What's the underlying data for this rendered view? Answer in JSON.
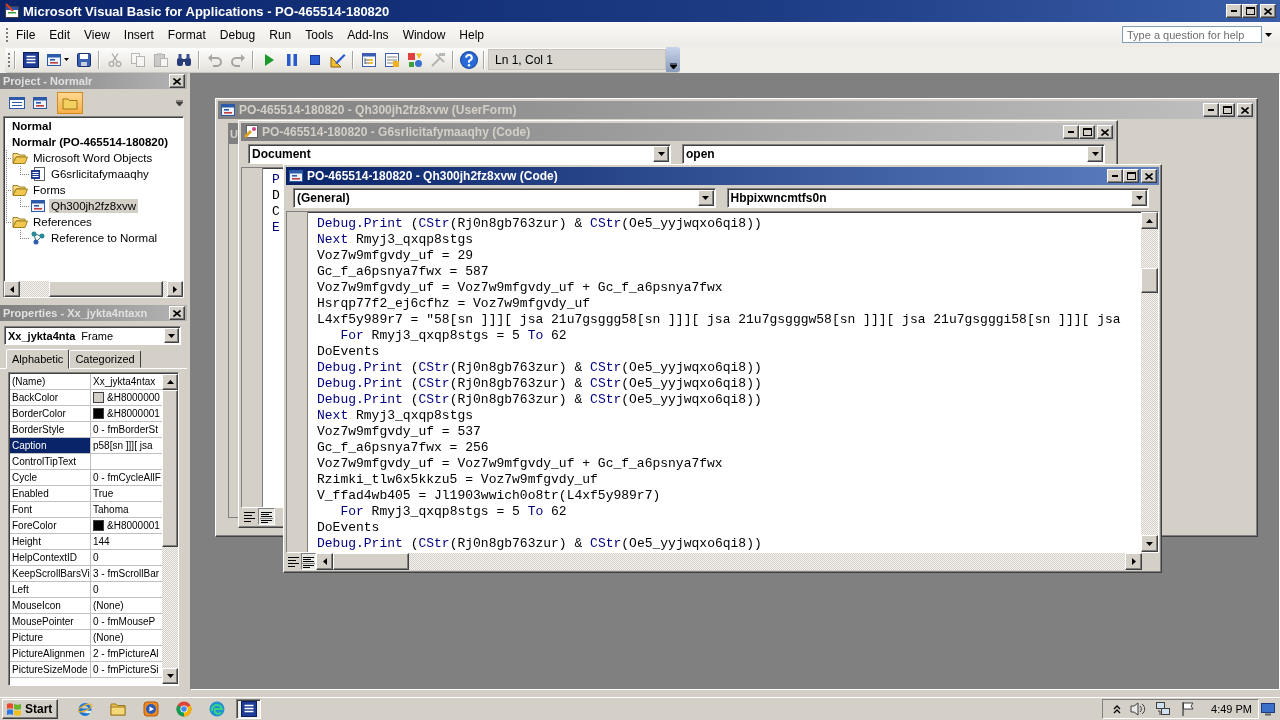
{
  "window": {
    "title": "Microsoft Visual Basic for Applications - PO-465514-180820"
  },
  "menu": [
    "File",
    "Edit",
    "View",
    "Insert",
    "Format",
    "Debug",
    "Run",
    "Tools",
    "Add-Ins",
    "Window",
    "Help"
  ],
  "help_box": {
    "placeholder": "Type a question for help"
  },
  "toolbar": {
    "groups": [
      [
        {
          "disabled": false
        },
        {
          "disabled": false
        },
        {
          "disabled": false
        }
      ],
      [
        {
          "disabled": true
        },
        {
          "disabled": true
        },
        {
          "disabled": true
        },
        {
          "disabled": false
        }
      ],
      [
        {
          "disabled": true
        },
        {
          "disabled": true
        }
      ],
      [
        {
          "disabled": false
        },
        {
          "disabled": false
        },
        {
          "disabled": false
        },
        {
          "disabled": false
        }
      ],
      [
        {
          "disabled": false
        },
        {
          "disabled": false
        },
        {
          "disabled": false
        },
        {
          "disabled": true
        }
      ],
      [
        {
          "disabled": false
        }
      ]
    ],
    "position": "Ln 1, Col 1"
  },
  "project": {
    "title": "Project - Normalr",
    "views": [
      {
        "selected": false
      },
      {
        "selected": false
      },
      {
        "selected": true
      }
    ],
    "tree": [
      {
        "label": "Normal",
        "kind": "project",
        "selected": false
      },
      {
        "label": "Normalr (PO-465514-180820)",
        "kind": "project",
        "selected": false,
        "children": [
          {
            "label": "Microsoft Word Objects",
            "kind": "folder",
            "selected": false,
            "children": [
              {
                "label": "G6srlicitafymaaqhy",
                "kind": "document",
                "selected": false
              }
            ]
          },
          {
            "label": "Forms",
            "kind": "folder",
            "selected": false,
            "children": [
              {
                "label": "Qh300jh2fz8xvw",
                "kind": "form",
                "selected": true
              }
            ]
          },
          {
            "label": "References",
            "kind": "folder",
            "selected": false,
            "children": [
              {
                "label": "Reference to Normal",
                "kind": "reference",
                "selected": false
              }
            ]
          }
        ]
      }
    ]
  },
  "properties": {
    "title": "Properties - Xx_jykta4ntaxn",
    "object": {
      "name": "Xx_jykta4nta",
      "type": "Frame"
    },
    "tabs": [
      {
        "label": "Alphabetic",
        "selected": true
      },
      {
        "label": "Categorized",
        "selected": false
      }
    ],
    "rows": [
      {
        "name": "(Name)",
        "value": "Xx_jykta4ntax",
        "selected": false
      },
      {
        "name": "BackColor",
        "value": "&H8000000",
        "color": "#d4d0c8",
        "selected": false
      },
      {
        "name": "BorderColor",
        "value": "&H8000001",
        "color": "#000000",
        "selected": false
      },
      {
        "name": "BorderStyle",
        "value": "0 - fmBorderSt",
        "selected": false
      },
      {
        "name": "Caption",
        "value": "p58[sn ]]][ jsa",
        "selected": true
      },
      {
        "name": "ControlTipText",
        "selected": false
      },
      {
        "name": "Cycle",
        "value": "0 - fmCycleAllF",
        "selected": false
      },
      {
        "name": "Enabled",
        "value": "True",
        "selected": false
      },
      {
        "name": "Font",
        "value": "Tahoma",
        "selected": false
      },
      {
        "name": "ForeColor",
        "value": "&H8000001",
        "color": "#000000",
        "selected": false
      },
      {
        "name": "Height",
        "value": "144",
        "selected": false
      },
      {
        "name": "HelpContextID",
        "value": "0",
        "selected": false
      },
      {
        "name": "KeepScrollBarsVi",
        "value": "3 - fmScrollBar",
        "selected": false
      },
      {
        "name": "Left",
        "value": "0",
        "selected": false
      },
      {
        "name": "MouseIcon",
        "value": "(None)",
        "selected": false
      },
      {
        "name": "MousePointer",
        "value": "0 - fmMouseP",
        "selected": false
      },
      {
        "name": "Picture",
        "value": "(None)",
        "selected": false
      },
      {
        "name": "PictureAlignmen",
        "value": "2 - fmPictureAl",
        "selected": false
      },
      {
        "name": "PictureSizeMode",
        "value": "0 - fmPictureSi",
        "selected": false
      }
    ]
  },
  "mdi_windows": [
    {
      "kind": "form",
      "title": "PO-465514-180820 - Qh300jh2fz8xvw (UserForm)",
      "active": false,
      "form_caption": "U"
    },
    {
      "kind": "code",
      "title": "PO-465514-180820 - G6srlicitafymaaqhy (Code)",
      "active": false,
      "object": "Document",
      "procedure": "open",
      "view_buttons": [
        {
          "selected": false
        },
        {
          "selected": true
        }
      ],
      "lines": [
        [
          {
            "text": "P",
            "kind": "keyword"
          }
        ],
        [
          {
            "text": "D",
            "kind": "plain"
          }
        ],
        [
          {
            "text": "C",
            "kind": "plain"
          }
        ],
        [
          {
            "text": "E",
            "kind": "keyword"
          }
        ]
      ]
    },
    {
      "kind": "code",
      "title": "PO-465514-180820 - Qh300jh2fz8xvw (Code)",
      "active": true,
      "object": "(General)",
      "procedure": "Hbpixwncmtfs0n",
      "view_buttons": [
        {
          "selected": false
        },
        {
          "selected": true
        }
      ],
      "lines": [
        [
          {
            "text": "Debug.Print",
            "kind": "keyword"
          },
          {
            "text": " (",
            "kind": "plain"
          },
          {
            "text": "CStr",
            "kind": "keyword"
          },
          {
            "text": "(Rj0n8gb763zur) & ",
            "kind": "plain"
          },
          {
            "text": "CStr",
            "kind": "keyword"
          },
          {
            "text": "(Oe5_yyjwqxo6qi8))",
            "kind": "plain"
          }
        ],
        [
          {
            "text": "Next",
            "kind": "keyword"
          },
          {
            "text": " Rmyj3_qxqp8stgs",
            "kind": "plain"
          }
        ],
        [
          {
            "text": "Voz7w9mfgvdy_uf = 29",
            "kind": "plain"
          }
        ],
        [
          {
            "text": "Gc_f_a6psnya7fwx = 587",
            "kind": "plain"
          }
        ],
        [
          {
            "text": "Voz7w9mfgvdy_uf = Voz7w9mfgvdy_uf + Gc_f_a6psnya7fwx",
            "kind": "plain"
          }
        ],
        [
          {
            "text": "Hsrqp77f2_ej6cfhz = Voz7w9mfgvdy_uf",
            "kind": "plain"
          }
        ],
        [
          {
            "text": "L4xf5y989r7 = \"58[sn ]]][ jsa 21u7gsggg58[sn ]]][ jsa 21u7gsgggw58[sn ]]][ jsa 21u7gsgggi58[sn ]]][ jsa",
            "kind": "plain"
          }
        ],
        [
          {
            "text": "   For",
            "kind": "keyword"
          },
          {
            "text": " Rmyj3_qxqp8stgs = 5 ",
            "kind": "plain"
          },
          {
            "text": "To",
            "kind": "keyword"
          },
          {
            "text": " 62",
            "kind": "plain"
          }
        ],
        [
          {
            "text": "DoEvents",
            "kind": "plain"
          }
        ],
        [
          {
            "text": "Debug.Print",
            "kind": "keyword"
          },
          {
            "text": " (",
            "kind": "plain"
          },
          {
            "text": "CStr",
            "kind": "keyword"
          },
          {
            "text": "(Rj0n8gb763zur) & ",
            "kind": "plain"
          },
          {
            "text": "CStr",
            "kind": "keyword"
          },
          {
            "text": "(Oe5_yyjwqxo6qi8))",
            "kind": "plain"
          }
        ],
        [
          {
            "text": "Debug.Print",
            "kind": "keyword"
          },
          {
            "text": " (",
            "kind": "plain"
          },
          {
            "text": "CStr",
            "kind": "keyword"
          },
          {
            "text": "(Rj0n8gb763zur) & ",
            "kind": "plain"
          },
          {
            "text": "CStr",
            "kind": "keyword"
          },
          {
            "text": "(Oe5_yyjwqxo6qi8))",
            "kind": "plain"
          }
        ],
        [
          {
            "text": "Debug.Print",
            "kind": "keyword"
          },
          {
            "text": " (",
            "kind": "plain"
          },
          {
            "text": "CStr",
            "kind": "keyword"
          },
          {
            "text": "(Rj0n8gb763zur) & ",
            "kind": "plain"
          },
          {
            "text": "CStr",
            "kind": "keyword"
          },
          {
            "text": "(Oe5_yyjwqxo6qi8))",
            "kind": "plain"
          }
        ],
        [
          {
            "text": "Next",
            "kind": "keyword"
          },
          {
            "text": " Rmyj3_qxqp8stgs",
            "kind": "plain"
          }
        ],
        [
          {
            "text": "Voz7w9mfgvdy_uf = 537",
            "kind": "plain"
          }
        ],
        [
          {
            "text": "Gc_f_a6psnya7fwx = 256",
            "kind": "plain"
          }
        ],
        [
          {
            "text": "Voz7w9mfgvdy_uf = Voz7w9mfgvdy_uf + Gc_f_a6psnya7fwx",
            "kind": "plain"
          }
        ],
        [
          {
            "text": "Rzimki_tlw6x5kkzu5 = Voz7w9mfgvdy_uf",
            "kind": "plain"
          }
        ],
        [
          {
            "text": "V_ffad4wb405 = Jl1903wwich0o8tr(L4xf5y989r7)",
            "kind": "plain"
          }
        ],
        [
          {
            "text": "   For",
            "kind": "keyword"
          },
          {
            "text": " Rmyj3_qxqp8stgs = 5 ",
            "kind": "plain"
          },
          {
            "text": "To",
            "kind": "keyword"
          },
          {
            "text": " 62",
            "kind": "plain"
          }
        ],
        [
          {
            "text": "DoEvents",
            "kind": "plain"
          }
        ],
        [
          {
            "text": "Debug.Print",
            "kind": "keyword"
          },
          {
            "text": " (",
            "kind": "plain"
          },
          {
            "text": "CStr",
            "kind": "keyword"
          },
          {
            "text": "(Rj0n8gb763zur) & ",
            "kind": "plain"
          },
          {
            "text": "CStr",
            "kind": "keyword"
          },
          {
            "text": "(Oe5_yyjwqxo6qi8))",
            "kind": "plain"
          }
        ]
      ]
    }
  ],
  "taskbar": {
    "start": "Start",
    "tasks": [
      {
        "selected": true
      }
    ],
    "clock": "4:49 PM"
  }
}
